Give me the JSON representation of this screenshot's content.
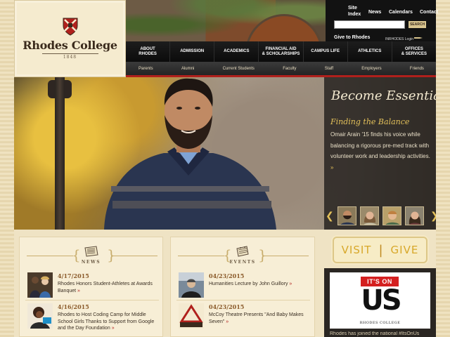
{
  "logo": {
    "name": "Rhodes College",
    "year": "1848"
  },
  "utility": {
    "links": [
      "Site Index",
      "News",
      "Calendars",
      "Contact"
    ],
    "search_label": "SEARCH",
    "give_link": "Give to Rhodes",
    "inrhodes": "INRHODES Login"
  },
  "main_nav": [
    "ABOUT\nRHODES",
    "ADMISSION",
    "ACADEMICS",
    "FINANCIAL AID\n& SCHOLARSHIPS",
    "CAMPUS LIFE",
    "ATHLETICS",
    "OFFICES\n& SERVICES"
  ],
  "sub_nav": [
    "Parents",
    "Alumni",
    "Current Students",
    "Faculty",
    "Staff",
    "Employers",
    "Friends"
  ],
  "hero": {
    "title": "Become Essential",
    "subtitle": "Finding the Balance",
    "body": "Omair Arain '15 finds his voice while balancing a rigorous pre-med track with volunteer work and leadership activities.",
    "more": "»",
    "prev_arrow": "❮",
    "next_arrow": "❯"
  },
  "news": {
    "label": "NEWS",
    "items": [
      {
        "date": "4/17/2015",
        "text": "Rhodes Honors Student-Athletes at Awards Banquet"
      },
      {
        "date": "4/16/2015",
        "text": "Rhodes to Host Coding Camp for Middle School Girls Thanks to Support from Google and the Day Foundation"
      }
    ]
  },
  "events": {
    "label": "EVENTS",
    "items": [
      {
        "date": "04/23/2015",
        "text": "Humanities Lecture by John Guillory"
      },
      {
        "date": "04/23/2015",
        "text": "McCoy Theatre Presents \"And Baby Makes Seven\""
      }
    ]
  },
  "raquo": "»",
  "visit": "VISIT",
  "give": "GIVE",
  "visit_give_sep": "|",
  "itsonus": {
    "top": "IT'S ON",
    "big": "US",
    "college": "RHODES COLLEGE",
    "caption": "Rhodes has joined the national #ItsOnUs"
  },
  "colors": {
    "accent_red": "#b0201c",
    "gold": "#e3c05a",
    "nav_black": "#121212",
    "cream": "#efe3c4"
  }
}
